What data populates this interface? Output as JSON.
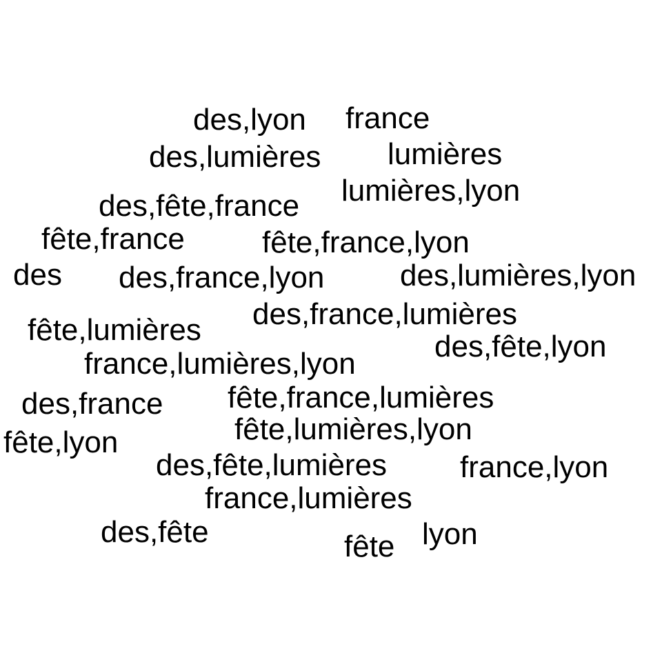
{
  "text_color": "#000000",
  "background_color": "#ffffff",
  "words": [
    "des,lyon",
    "france",
    "des,lumières",
    "lumières",
    "lumières,lyon",
    "des,fête,france",
    "fête,france",
    "fête,france,lyon",
    "des",
    "des,france,lyon",
    "des,lumières,lyon",
    "des,france,lumières",
    "fête,lumières",
    "des,fête,lyon",
    "france,lumières,lyon",
    "fête,france,lumières",
    "des,france",
    "fête,lumières,lyon",
    "fête,lyon",
    "des,fête,lumières",
    "france,lyon",
    "france,lumières",
    "des,fête",
    "lyon",
    "fête"
  ]
}
